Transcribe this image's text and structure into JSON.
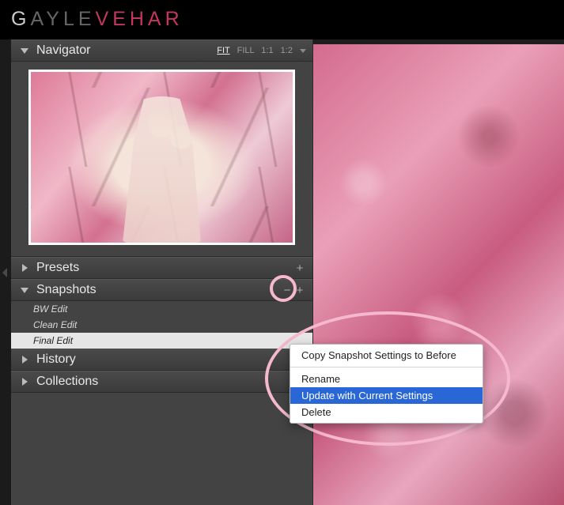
{
  "brand": {
    "part1": "G",
    "part2": "AYLE",
    "part3": "VEHAR"
  },
  "navigator": {
    "title": "Navigator",
    "zoom": {
      "fit": "FIT",
      "fill": "FILL",
      "r1": "1:1",
      "r2": "1:2"
    }
  },
  "panels": {
    "presets": "Presets",
    "snapshots": "Snapshots",
    "history": "History",
    "collections": "Collections"
  },
  "snapshots": {
    "items": [
      "BW Edit",
      "Clean Edit",
      "Final Edit"
    ],
    "selectedIndex": 2
  },
  "contextMenu": {
    "copy": "Copy Snapshot Settings to Before",
    "rename": "Rename",
    "update": "Update with Current Settings",
    "delete": "Delete",
    "highlighted": "update"
  },
  "icons": {
    "plus": "+",
    "minus": "−",
    "chevron": "◂"
  }
}
